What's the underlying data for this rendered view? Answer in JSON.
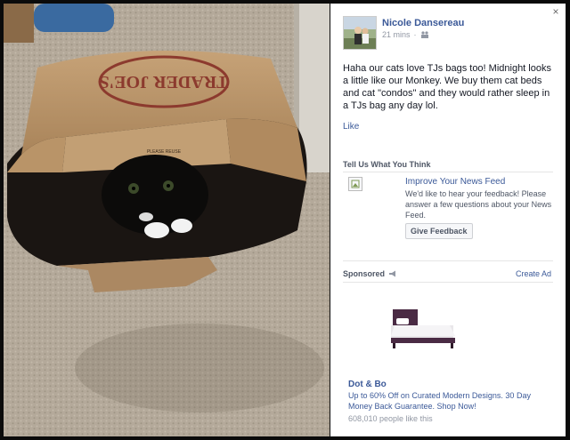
{
  "post": {
    "author": "Nicole Dansereau",
    "time": "21 mins",
    "caption": "Haha our cats love TJs bags too! Midnight looks a little like our Monkey. We buy them cat beds and cat \"condos\" and they would rather sleep in a TJs bag any day lol.",
    "like_label": "Like",
    "audience_icon": "people-icon"
  },
  "photo": {
    "bag_brand": "TRADER JOE'S",
    "bag_small_text": "PLEASE REUSE"
  },
  "close_label": "×",
  "feedback": {
    "section_title": "Tell Us What You Think",
    "title": "Improve Your News Feed",
    "description": "We'd like to hear your feedback! Please answer a few questions about your News Feed.",
    "button_label": "Give Feedback"
  },
  "sponsored": {
    "label": "Sponsored",
    "create_ad_label": "Create Ad",
    "megaphone_icon": "megaphone-icon",
    "ad": {
      "name": "Dot & Bo",
      "description": "Up to 60% Off on Curated Modern Designs. 30 Day Money Back Guarantee. Shop Now!",
      "likes": "608,010 people like this"
    }
  },
  "colors": {
    "link": "#3b5998",
    "meta": "#9197a3",
    "text": "#141823",
    "bed_frame": "#4a2b44"
  }
}
